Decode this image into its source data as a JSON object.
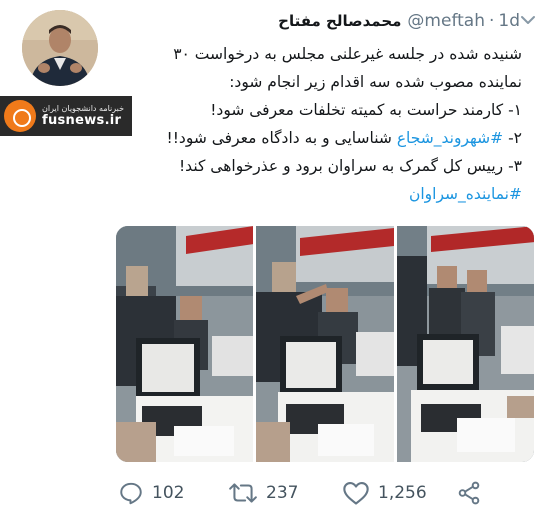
{
  "author": {
    "display_name": "محمدصالح مفتاح",
    "handle": "@meftah",
    "separator": "·",
    "time": "1d"
  },
  "tweet": {
    "lines": [
      "شنیده شده در جلسه غیرعلنی مجلس به درخواست ۳۰",
      "نماینده مصوب شده سه اقدام زیر انجام شود:",
      "۱- کارمند حراست به کمیته تخلفات معرفی شود!",
      "۳- رییس کل گمرک به سراوان برود و عذرخواهی کند!"
    ],
    "line2_prefix": "۲- ",
    "line2_hashtag": "#شهروند_شجاع",
    "line2_suffix": " شناسایی و به دادگاه معرفی شود!!",
    "hashtag_line": "#نماینده_سراوان"
  },
  "watermark": {
    "site": "fusnews.ir",
    "tagline": "خبرنامه دانشجویان ایران"
  },
  "actions": {
    "replies": "102",
    "retweets": "237",
    "likes": "1,256"
  },
  "colors": {
    "link": "#1b95e0",
    "muted": "#657786",
    "text": "#14171a"
  },
  "icons": [
    "chevron-down-icon",
    "reply-icon",
    "retweet-icon",
    "like-icon",
    "share-icon"
  ]
}
